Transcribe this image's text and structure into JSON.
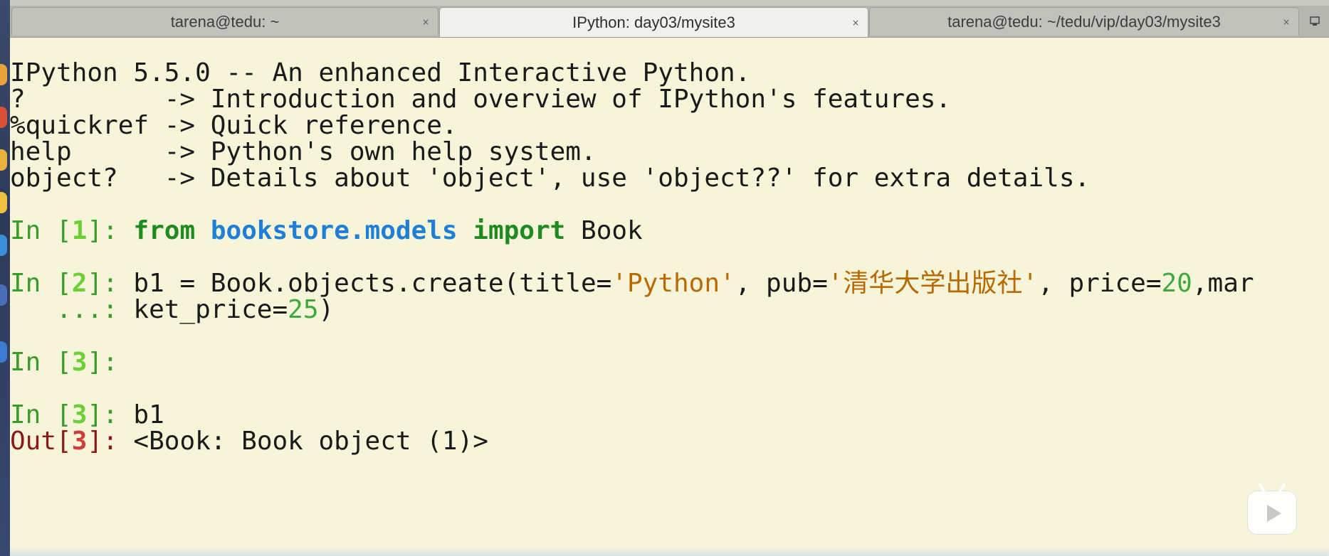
{
  "tabs": [
    {
      "title": "tarena@tedu: ~",
      "close": "×"
    },
    {
      "title": "IPython: day03/mysite3",
      "close": "×"
    },
    {
      "title": "tarena@tedu: ~/tedu/vip/day03/mysite3",
      "close": "×"
    }
  ],
  "banner": [
    "IPython 5.5.0 -- An enhanced Interactive Python.",
    "?         -> Introduction and overview of IPython's features.",
    "%quickref -> Quick reference.",
    "help      -> Python's own help system.",
    "object?   -> Details about 'object', use 'object??' for extra details."
  ],
  "cells": {
    "in1": {
      "prompt_open": "In [",
      "num": "1",
      "prompt_close": "]: ",
      "kw_from": "from",
      "module": "bookstore.models",
      "kw_import": "import",
      "name": "Book"
    },
    "in2": {
      "prompt_open": "In [",
      "num": "2",
      "prompt_close": "]: ",
      "code_a": "b1 = Book.objects.create(title=",
      "str_title": "'Python'",
      "code_b": ", pub=",
      "str_pub": "'清华大学出版社'",
      "code_c": ", price=",
      "num_price": "20",
      "code_d": ",mar",
      "cont_prompt": "   ...: ",
      "code_e": "ket_price=",
      "num_market": "25",
      "code_f": ")"
    },
    "in3a": {
      "prompt_open": "In [",
      "num": "3",
      "prompt_close": "]: "
    },
    "in3b": {
      "prompt_open": "In [",
      "num": "3",
      "prompt_close": "]: ",
      "code": "b1"
    },
    "out3": {
      "prompt_open": "Out[",
      "num": "3",
      "prompt_close": "]: ",
      "result": "<Book: Book object (1)>"
    }
  },
  "icons": {
    "tab_menu": "tab-menu-icon",
    "watermark": "video-play-icon"
  },
  "colors": {
    "background": "#f6f5da",
    "prompt_green": "#3a9a2a",
    "keyword": "#1f8a1f",
    "module": "#1f7fd4",
    "string": "#b86a00",
    "number": "#3fa83f",
    "out_prompt": "#8a1a1a"
  }
}
